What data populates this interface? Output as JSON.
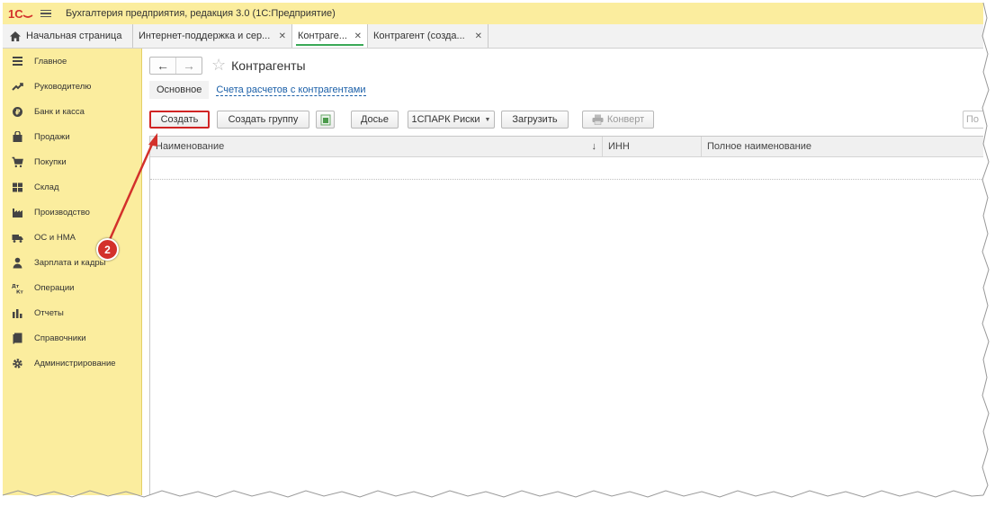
{
  "titlebar": {
    "logo": "1С",
    "title": "Бухгалтерия предприятия, редакция 3.0  (1С:Предприятие)"
  },
  "tabs": [
    {
      "label": "Начальная страница",
      "icon": "home-icon",
      "closable": false
    },
    {
      "label": "Интернет-поддержка и сер...",
      "closable": true
    },
    {
      "label": "Контраге...",
      "closable": true,
      "active": true
    },
    {
      "label": "Контрагент (созда...",
      "closable": true
    }
  ],
  "sidebar": {
    "items": [
      {
        "label": "Главное",
        "icon": "list-icon"
      },
      {
        "label": "Руководителю",
        "icon": "trend-icon"
      },
      {
        "label": "Банк и касса",
        "icon": "coin-icon"
      },
      {
        "label": "Продажи",
        "icon": "bag-icon"
      },
      {
        "label": "Покупки",
        "icon": "cart-icon"
      },
      {
        "label": "Склад",
        "icon": "warehouse-icon"
      },
      {
        "label": "Производство",
        "icon": "factory-icon"
      },
      {
        "label": "ОС и НМА",
        "icon": "truck-icon"
      },
      {
        "label": "Зарплата и кадры",
        "icon": "person-icon"
      },
      {
        "label": "Операции",
        "icon": "dt-kt-icon"
      },
      {
        "label": "Отчеты",
        "icon": "bar-chart-icon"
      },
      {
        "label": "Справочники",
        "icon": "book-icon"
      },
      {
        "label": "Администрирование",
        "icon": "gear-icon"
      }
    ]
  },
  "form": {
    "title": "Контрагенты",
    "back": "←",
    "forward": "→",
    "star": "☆",
    "subtab_main": "Основное",
    "subtab_link": "Счета расчетов с контрагентами"
  },
  "toolbar": {
    "create": "Создать",
    "create_group": "Создать группу",
    "dossier": "Досье",
    "spark": "1СПАРК Риски",
    "load": "Загрузить",
    "envelope": "Конверт",
    "search_placeholder": "По"
  },
  "table": {
    "columns": [
      "Наименование",
      "ИНН",
      "Полное наименование"
    ],
    "sort_indicator": "↓"
  },
  "annotation": {
    "badge": "2",
    "color": "#d3312b"
  }
}
